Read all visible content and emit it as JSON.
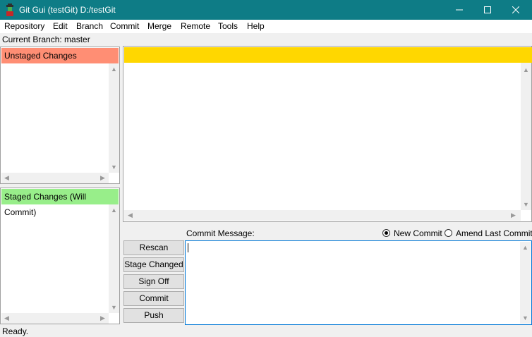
{
  "window": {
    "title": "Git Gui (testGit) D:/testGit",
    "controls": {
      "minimize": "—",
      "maximize": "☐",
      "close": "✕"
    }
  },
  "menu": {
    "items": [
      "Repository",
      "Edit",
      "Branch",
      "Commit",
      "Merge",
      "Remote",
      "Tools",
      "Help"
    ]
  },
  "branch": {
    "label": "Current Branch: master"
  },
  "unstaged": {
    "header": "Unstaged Changes",
    "header_color": "#ff8e74"
  },
  "staged": {
    "header": "Staged Changes (Will Commit)",
    "header_color": "#98ee8a"
  },
  "diff": {
    "header_color": "#ffd700"
  },
  "commit": {
    "message_label": "Commit Message:",
    "new_commit_label": "New Commit",
    "amend_label": "Amend Last Commit",
    "selected_mode": "New Commit"
  },
  "buttons": {
    "rescan": "Rescan",
    "stage_changed": "Stage Changed",
    "sign_off": "Sign Off",
    "commit": "Commit",
    "push": "Push"
  },
  "status": {
    "text": "Ready."
  },
  "colors": {
    "titlebar": "#0e7c86",
    "focus_border": "#0078d7"
  }
}
